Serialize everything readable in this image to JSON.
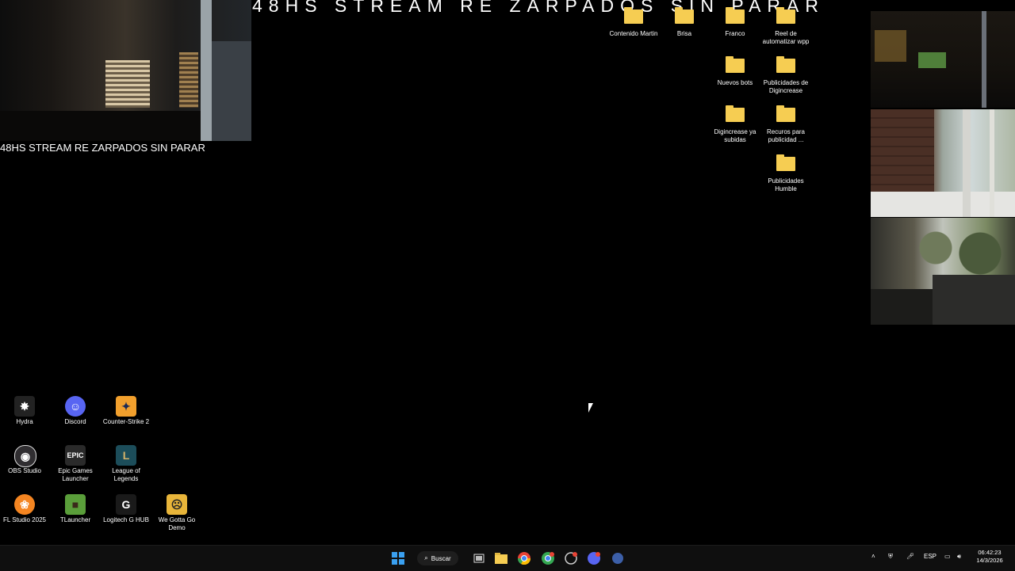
{
  "banner": {
    "top_text": "48HS STREAM RE ZARPADOS SIN PARAR",
    "left_text": "48HS STREAM RE ZARPADOS SIN PARAR"
  },
  "folders": [
    {
      "label": "Contenido Martin"
    },
    {
      "label": "Brisa"
    },
    {
      "label": "Franco"
    },
    {
      "label": "Reel de automatizar wpp"
    },
    {
      "label": "Nuevos bots"
    },
    {
      "label": "Publicidades de Digincrease"
    },
    {
      "label": "Digincrease ya subidas"
    },
    {
      "label": "Recuros para publicidad ..."
    },
    {
      "label": "Publicidades Humble"
    }
  ],
  "apps": [
    {
      "label": "Hydra",
      "icon": "hydra-icon",
      "color": "#ffffff"
    },
    {
      "label": "Discord",
      "icon": "discord-icon",
      "color": "#5865f2"
    },
    {
      "label": "Counter-Strike 2",
      "icon": "counter-strike-icon",
      "color": "#f2a02d"
    },
    {
      "label": "OBS Studio",
      "icon": "obs-icon",
      "color": "#302e31"
    },
    {
      "label": "Epic Games Launcher",
      "icon": "epic-games-icon",
      "color": "#2a2a2a"
    },
    {
      "label": "League of Legends",
      "icon": "league-of-legends-icon",
      "color": "#1c4d5a"
    },
    {
      "label": "FL Studio 2025",
      "icon": "fl-studio-icon",
      "color": "#f48521"
    },
    {
      "label": "TLauncher",
      "icon": "tlauncher-icon",
      "color": "#5a9e3a"
    },
    {
      "label": "Logitech G HUB",
      "icon": "logitech-icon",
      "color": "#1a1a1a"
    },
    {
      "label": "We Gotta Go Demo",
      "icon": "we-gotta-go-icon",
      "color": "#e8b53a"
    }
  ],
  "taskbar": {
    "search_label": "Buscar",
    "language": "ESP",
    "time": "06:42:23",
    "date": "14/3/2026"
  }
}
